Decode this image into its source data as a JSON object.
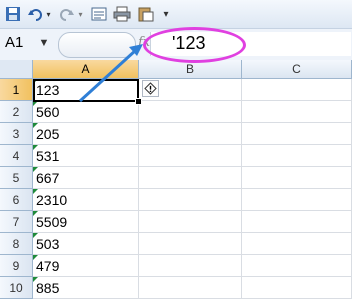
{
  "toolbar": {
    "icons": [
      "save-icon",
      "undo-icon",
      "undo-dropdown-icon",
      "redo-icon",
      "redo-dropdown-icon",
      "form-icon",
      "print-icon",
      "paste-icon",
      "customize-icon"
    ]
  },
  "formula_bar": {
    "name_box": "A1",
    "fx_label": "fx",
    "content": "'123"
  },
  "columns": [
    "A",
    "B",
    "C"
  ],
  "rows": [
    {
      "num": "1",
      "a": "123"
    },
    {
      "num": "2",
      "a": "560"
    },
    {
      "num": "3",
      "a": "205"
    },
    {
      "num": "4",
      "a": "531"
    },
    {
      "num": "5",
      "a": "667"
    },
    {
      "num": "6",
      "a": "2310"
    },
    {
      "num": "7",
      "a": "5509"
    },
    {
      "num": "8",
      "a": "503"
    },
    {
      "num": "9",
      "a": "479"
    },
    {
      "num": "10",
      "a": "885"
    }
  ],
  "colors": {
    "highlight": "#e040e0",
    "arrow": "#2f7fd6",
    "error_indicator": "#1e8a3a"
  }
}
